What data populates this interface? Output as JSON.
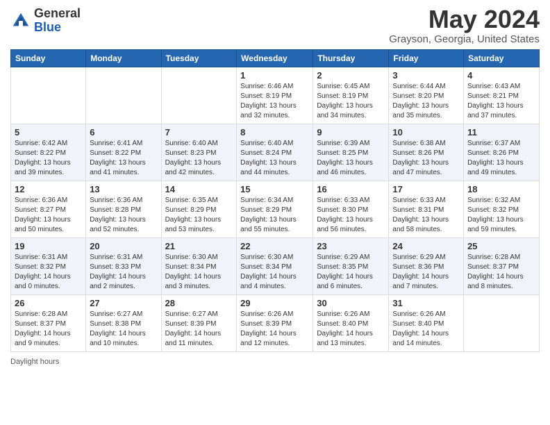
{
  "header": {
    "logo_general": "General",
    "logo_blue": "Blue",
    "month_title": "May 2024",
    "location": "Grayson, Georgia, United States"
  },
  "days_of_week": [
    "Sunday",
    "Monday",
    "Tuesday",
    "Wednesday",
    "Thursday",
    "Friday",
    "Saturday"
  ],
  "weeks": [
    [
      {
        "day": "",
        "info": ""
      },
      {
        "day": "",
        "info": ""
      },
      {
        "day": "",
        "info": ""
      },
      {
        "day": "1",
        "info": "Sunrise: 6:46 AM\nSunset: 8:19 PM\nDaylight: 13 hours and 32 minutes."
      },
      {
        "day": "2",
        "info": "Sunrise: 6:45 AM\nSunset: 8:19 PM\nDaylight: 13 hours and 34 minutes."
      },
      {
        "day": "3",
        "info": "Sunrise: 6:44 AM\nSunset: 8:20 PM\nDaylight: 13 hours and 35 minutes."
      },
      {
        "day": "4",
        "info": "Sunrise: 6:43 AM\nSunset: 8:21 PM\nDaylight: 13 hours and 37 minutes."
      }
    ],
    [
      {
        "day": "5",
        "info": "Sunrise: 6:42 AM\nSunset: 8:22 PM\nDaylight: 13 hours and 39 minutes."
      },
      {
        "day": "6",
        "info": "Sunrise: 6:41 AM\nSunset: 8:22 PM\nDaylight: 13 hours and 41 minutes."
      },
      {
        "day": "7",
        "info": "Sunrise: 6:40 AM\nSunset: 8:23 PM\nDaylight: 13 hours and 42 minutes."
      },
      {
        "day": "8",
        "info": "Sunrise: 6:40 AM\nSunset: 8:24 PM\nDaylight: 13 hours and 44 minutes."
      },
      {
        "day": "9",
        "info": "Sunrise: 6:39 AM\nSunset: 8:25 PM\nDaylight: 13 hours and 46 minutes."
      },
      {
        "day": "10",
        "info": "Sunrise: 6:38 AM\nSunset: 8:26 PM\nDaylight: 13 hours and 47 minutes."
      },
      {
        "day": "11",
        "info": "Sunrise: 6:37 AM\nSunset: 8:26 PM\nDaylight: 13 hours and 49 minutes."
      }
    ],
    [
      {
        "day": "12",
        "info": "Sunrise: 6:36 AM\nSunset: 8:27 PM\nDaylight: 13 hours and 50 minutes."
      },
      {
        "day": "13",
        "info": "Sunrise: 6:36 AM\nSunset: 8:28 PM\nDaylight: 13 hours and 52 minutes."
      },
      {
        "day": "14",
        "info": "Sunrise: 6:35 AM\nSunset: 8:29 PM\nDaylight: 13 hours and 53 minutes."
      },
      {
        "day": "15",
        "info": "Sunrise: 6:34 AM\nSunset: 8:29 PM\nDaylight: 13 hours and 55 minutes."
      },
      {
        "day": "16",
        "info": "Sunrise: 6:33 AM\nSunset: 8:30 PM\nDaylight: 13 hours and 56 minutes."
      },
      {
        "day": "17",
        "info": "Sunrise: 6:33 AM\nSunset: 8:31 PM\nDaylight: 13 hours and 58 minutes."
      },
      {
        "day": "18",
        "info": "Sunrise: 6:32 AM\nSunset: 8:32 PM\nDaylight: 13 hours and 59 minutes."
      }
    ],
    [
      {
        "day": "19",
        "info": "Sunrise: 6:31 AM\nSunset: 8:32 PM\nDaylight: 14 hours and 0 minutes."
      },
      {
        "day": "20",
        "info": "Sunrise: 6:31 AM\nSunset: 8:33 PM\nDaylight: 14 hours and 2 minutes."
      },
      {
        "day": "21",
        "info": "Sunrise: 6:30 AM\nSunset: 8:34 PM\nDaylight: 14 hours and 3 minutes."
      },
      {
        "day": "22",
        "info": "Sunrise: 6:30 AM\nSunset: 8:34 PM\nDaylight: 14 hours and 4 minutes."
      },
      {
        "day": "23",
        "info": "Sunrise: 6:29 AM\nSunset: 8:35 PM\nDaylight: 14 hours and 6 minutes."
      },
      {
        "day": "24",
        "info": "Sunrise: 6:29 AM\nSunset: 8:36 PM\nDaylight: 14 hours and 7 minutes."
      },
      {
        "day": "25",
        "info": "Sunrise: 6:28 AM\nSunset: 8:37 PM\nDaylight: 14 hours and 8 minutes."
      }
    ],
    [
      {
        "day": "26",
        "info": "Sunrise: 6:28 AM\nSunset: 8:37 PM\nDaylight: 14 hours and 9 minutes."
      },
      {
        "day": "27",
        "info": "Sunrise: 6:27 AM\nSunset: 8:38 PM\nDaylight: 14 hours and 10 minutes."
      },
      {
        "day": "28",
        "info": "Sunrise: 6:27 AM\nSunset: 8:39 PM\nDaylight: 14 hours and 11 minutes."
      },
      {
        "day": "29",
        "info": "Sunrise: 6:26 AM\nSunset: 8:39 PM\nDaylight: 14 hours and 12 minutes."
      },
      {
        "day": "30",
        "info": "Sunrise: 6:26 AM\nSunset: 8:40 PM\nDaylight: 14 hours and 13 minutes."
      },
      {
        "day": "31",
        "info": "Sunrise: 6:26 AM\nSunset: 8:40 PM\nDaylight: 14 hours and 14 minutes."
      },
      {
        "day": "",
        "info": ""
      }
    ]
  ],
  "footer": {
    "daylight_label": "Daylight hours"
  }
}
